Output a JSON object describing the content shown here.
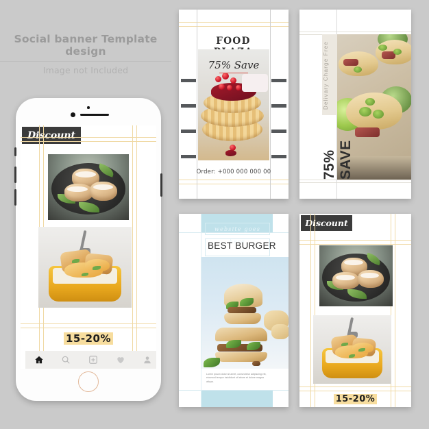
{
  "heading": {
    "title": "Social banner Template design",
    "subtitle": "Image not Included"
  },
  "colors": {
    "background": "#cacaca",
    "card": "#ffffff",
    "gold_grid": "#f0d9a4",
    "dark_badge": "#3b3b3b",
    "tick_dark": "#55585b",
    "accent_red": "#d9544f",
    "blue_panel": "#bfe1ea",
    "highlight_yellow": "#f7dd9e"
  },
  "phone": {
    "name": "smartphone-mockup",
    "screen": {
      "badge_label": "Discount",
      "percent_prefix": "15-20",
      "percent_suffix": "%",
      "photo_top": "cinnamon-rolls-on-dark-plate",
      "photo_bottom": "casserole-in-yellow-dish"
    },
    "navbar": {
      "items": [
        {
          "icon": "home-icon",
          "label": "Home",
          "active": true
        },
        {
          "icon": "search-icon",
          "label": "Search",
          "active": false
        },
        {
          "icon": "add-icon",
          "label": "Add",
          "active": false
        },
        {
          "icon": "heart-icon",
          "label": "Likes",
          "active": false
        },
        {
          "icon": "profile-icon",
          "label": "Profile",
          "active": false
        }
      ]
    },
    "home_button": "home-button"
  },
  "cards": [
    {
      "id": "food-plaza",
      "title": "FOOD PLAZA",
      "save_text": "75% Save",
      "order_text": "Order: +000 000 000 00",
      "photo": "waffles-with-red-currants-and-jam",
      "tick_count": 4
    },
    {
      "id": "taco-save",
      "vertical_small": "Delivary Charge Free",
      "vertical_large": "75% SAVE",
      "photo": "street-tacos-with-lime-and-salsa"
    },
    {
      "id": "best-burger",
      "website_label": "website goes here",
      "title": "BEST BURGER",
      "body_text": "Lorem ipsum dolor sit amet, consectetur adipiscing elit, eiusmod tempor incididunt ut labore et dolore magna aliqua.",
      "photo": "stacked-burger-sandwiches"
    },
    {
      "id": "discount-15-20",
      "badge_label": "Discount",
      "percent_prefix": "15-20",
      "percent_suffix": "%",
      "photo_top": "cinnamon-rolls-on-dark-plate",
      "photo_bottom": "casserole-in-yellow-dish"
    }
  ]
}
